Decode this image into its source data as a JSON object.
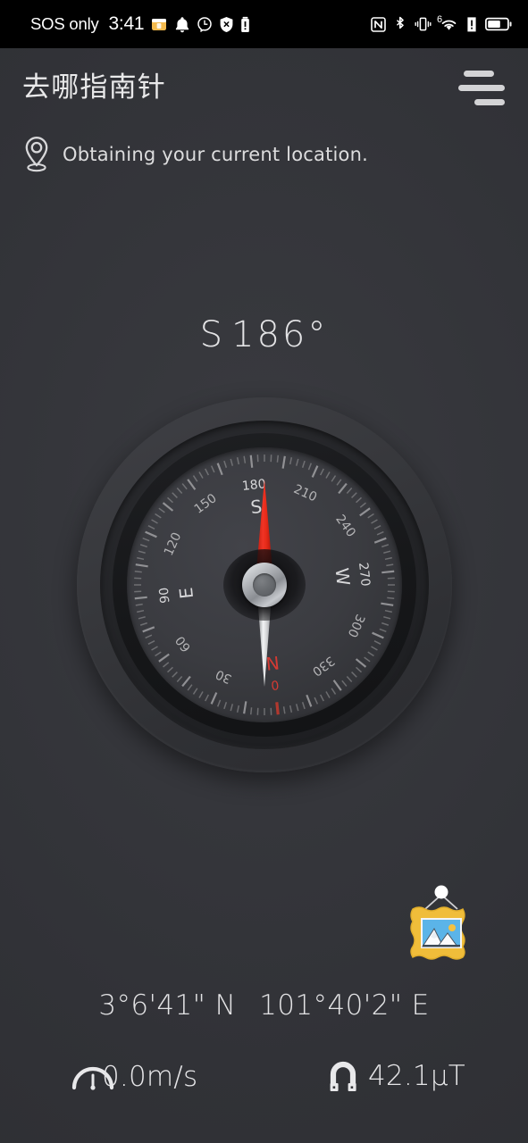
{
  "statusbar": {
    "carrier": "SOS only",
    "time": "3:41",
    "left_icons": [
      "folder-lock-icon",
      "bell-icon",
      "alarm-icon",
      "shield-x-icon",
      "battery-saver-icon"
    ],
    "right_icons": [
      "nfc-icon",
      "bluetooth-icon",
      "vibrate-icon",
      "wifi-6-icon",
      "signal-alert-icon",
      "battery-icon"
    ],
    "wifi_generation": "6",
    "background": "#000000"
  },
  "appbar": {
    "title": "去哪指南针",
    "menu_icon": "hamburger-menu-icon"
  },
  "location_status": {
    "icon": "location-pin-icon",
    "text": "Obtaining your current location."
  },
  "heading": {
    "direction": "S",
    "degrees": "186°",
    "full": "S  186°"
  },
  "compass": {
    "rotation_deg": -186,
    "cardinals": [
      {
        "label": "N",
        "angle": 0,
        "color": "#d43a33"
      },
      {
        "label": "E",
        "angle": 90,
        "color": "#d8d8da"
      },
      {
        "label": "S",
        "angle": 180,
        "color": "#d8d8da"
      },
      {
        "label": "W",
        "angle": 270,
        "color": "#d8d8da"
      }
    ],
    "degree_labels": [
      {
        "label": "0",
        "angle": 0,
        "color": "#d43a33"
      },
      {
        "label": "30",
        "angle": 30,
        "color": "#b4b4b6"
      },
      {
        "label": "60",
        "angle": 60,
        "color": "#b4b4b6"
      },
      {
        "label": "90",
        "angle": 90,
        "color": "#d8d8da"
      },
      {
        "label": "120",
        "angle": 120,
        "color": "#b4b4b6"
      },
      {
        "label": "150",
        "angle": 150,
        "color": "#b4b4b6"
      },
      {
        "label": "180",
        "angle": 180,
        "color": "#d8d8da"
      },
      {
        "label": "210",
        "angle": 210,
        "color": "#b4b4b6"
      },
      {
        "label": "240",
        "angle": 240,
        "color": "#b4b4b6"
      },
      {
        "label": "270",
        "angle": 270,
        "color": "#d8d8da"
      },
      {
        "label": "300",
        "angle": 300,
        "color": "#b4b4b6"
      },
      {
        "label": "330",
        "angle": 330,
        "color": "#b4b4b6"
      }
    ],
    "needle_north_color": "#dededf",
    "needle_south_color": "#e22b18",
    "north_tick_color": "#c0392e",
    "tick_color": "#9a9a9d"
  },
  "photo_button": {
    "icon": "picture-frame-icon",
    "frame_color": "#f0bd3a",
    "sky_color": "#5bb4e8",
    "sun_color": "#f5c242"
  },
  "coordinates": {
    "latitude": "3°6'41\" N",
    "longitude": "101°40'2\" E"
  },
  "sensors": {
    "speed": {
      "icon": "speedometer-icon",
      "value": "0.0m/s"
    },
    "magnetic_field": {
      "icon": "magnet-icon",
      "value": "42.1μT"
    }
  },
  "theme": {
    "background": "#333438",
    "text_primary": "#e3e3e5",
    "accent_red": "#e22b18"
  }
}
